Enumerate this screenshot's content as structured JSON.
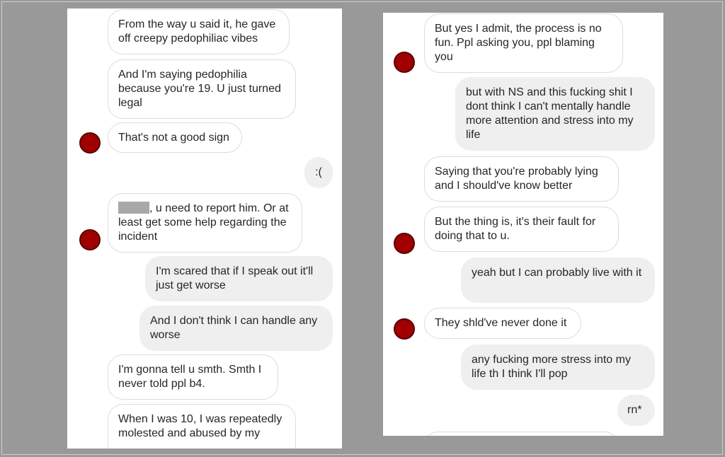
{
  "left": {
    "messages": [
      {
        "from": "them",
        "text": "From the way u said it, he gave off creepy pedophiliac vibes"
      },
      {
        "from": "them",
        "text": "And I'm saying pedophilia because you're 19. U just turned legal"
      },
      {
        "from": "them",
        "text": "That's not a good sign"
      },
      {
        "from": "me",
        "text": ":("
      },
      {
        "from": "them",
        "text": ", u need to report him. Or at least get some help regarding the incident",
        "redacted_prefix": true
      },
      {
        "from": "me",
        "text": "I'm scared that if I speak out it'll just get worse"
      },
      {
        "from": "me",
        "text": "And I don't think I can handle any worse"
      },
      {
        "from": "them",
        "text": "I'm gonna tell u smth. Smth I never told ppl b4."
      },
      {
        "from": "them",
        "text": "When I was 10, I was repeatedly molested and abused by my"
      }
    ]
  },
  "right": {
    "messages": [
      {
        "from": "them",
        "text": "But yes I admit, the process is no fun. Ppl asking you, ppl blaming you"
      },
      {
        "from": "me",
        "text": "but with NS and this fucking shit I dont think I can't mentally handle more attention and stress into my life"
      },
      {
        "from": "them",
        "text": "Saying that you're probably lying and I should've know better"
      },
      {
        "from": "them",
        "text": "But the thing is, it's their fault for doing that to u."
      },
      {
        "from": "me",
        "text": "yeah but I can probably live with it"
      },
      {
        "from": "them",
        "text": "They shld've never done it"
      },
      {
        "from": "me",
        "text": "any fucking more stress into my life th I think I'll pop"
      },
      {
        "from": "me",
        "text": "rn*"
      }
    ]
  },
  "colors": {
    "background": "#999999",
    "panel": "#ffffff",
    "incoming_border": "#dbdbdb",
    "outgoing_fill": "#efefef",
    "avatar": "#a00000",
    "redaction": "#a8a8a8"
  }
}
